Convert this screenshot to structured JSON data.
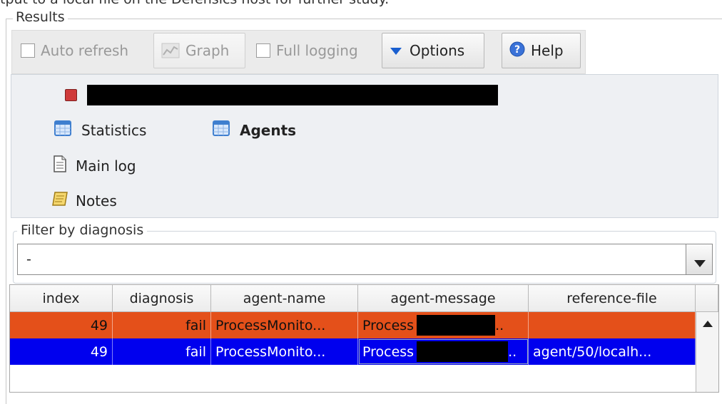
{
  "top_caption": "tput to a local file on the Defensics host for further study.",
  "results": {
    "title": "Results",
    "toolbar": {
      "auto_refresh": "Auto refresh",
      "graph": "Graph",
      "full_logging": "Full logging",
      "options": "Options",
      "help": "Help"
    },
    "tree": {
      "statistics": "Statistics",
      "agents": "Agents",
      "main_log": "Main log",
      "notes": "Notes"
    }
  },
  "filter": {
    "label": "Filter by diagnosis",
    "selected": "-"
  },
  "table": {
    "columns": [
      "index",
      "diagnosis",
      "agent-name",
      "agent-message",
      "reference-file"
    ],
    "rows": [
      {
        "index": "49",
        "diagnosis": "fail",
        "agent_name": "ProcessMonito...",
        "agent_message": "Process",
        "agent_message_tail": "..",
        "reference_file": ""
      },
      {
        "index": "49",
        "diagnosis": "fail",
        "agent_name": "ProcessMonito...",
        "agent_message": "Process",
        "agent_message_tail": "..",
        "reference_file": "agent/50/localh..."
      }
    ]
  },
  "colors": {
    "row_fail": "#e4501a",
    "row_selected": "#0000ee",
    "panel": "#eef0f3"
  }
}
